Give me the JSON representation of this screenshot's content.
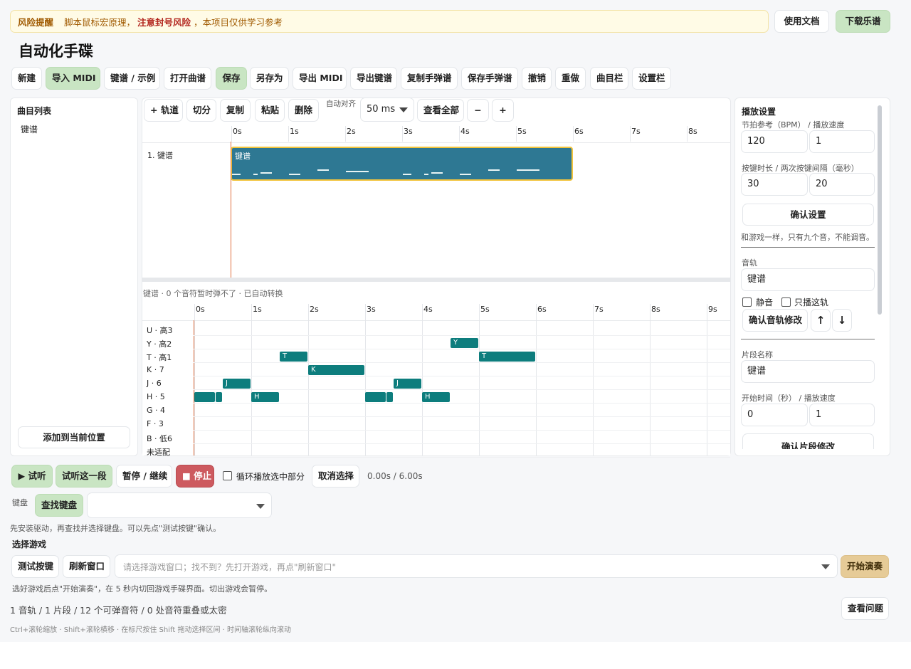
{
  "banner": {
    "title": "风险提醒",
    "text_a": "脚本鼠标宏原理，",
    "text_emph": "注意封号风险",
    "text_b": "，本项目仅供学习参考",
    "docs_button": "使用文档",
    "download_button": "下载乐谱"
  },
  "app_title": "自动化手碟",
  "toolbar": {
    "new": "新建",
    "import_midi": "导入 MIDI",
    "keyscore_example": "键谱 / 示例",
    "open_song": "打开曲谱",
    "save": "保存",
    "save_as": "另存为",
    "export_midi": "导出 MIDI",
    "export_keyscore": "导出键谱",
    "copy_handscore": "复制手弹谱",
    "save_handscore": "保存手弹谱",
    "undo": "撤销",
    "redo": "重做",
    "song_bar": "曲目栏",
    "settings_bar": "设置栏"
  },
  "song_list": {
    "title": "曲目列表",
    "items": [
      "键谱"
    ],
    "add_button": "添加到当前位置"
  },
  "editor_toolbar": {
    "add_track": "+ 轨道",
    "split": "切分",
    "copy": "复制",
    "paste": "粘贴",
    "delete": "删除",
    "snap_label": "自动对齐",
    "snap_value": "50 ms",
    "view_all": "查看全部",
    "zoom_out": "−",
    "zoom_in": "+"
  },
  "timeline": {
    "ticks": [
      "0s",
      "1s",
      "2s",
      "3s",
      "4s",
      "5s",
      "6s",
      "7s",
      "8s"
    ],
    "track_name": "1. 键谱",
    "clip_name": "键谱",
    "clip_start_s": 0,
    "clip_end_s": 6
  },
  "piano_roll": {
    "status": "键谱 · 0 个音符暂时弹不了 · 已自动转换",
    "ticks": [
      "0s",
      "1s",
      "2s",
      "3s",
      "4s",
      "5s",
      "6s",
      "7s",
      "8s",
      "9s"
    ],
    "rows": [
      "U · 高3",
      "Y · 高2",
      "T · 高1",
      "K · 7",
      "J · 6",
      "H · 5",
      "G · 4",
      "F · 3",
      "B · 低6",
      "未适配"
    ],
    "notes": [
      {
        "row": 1,
        "start": 4.5,
        "end": 5.0,
        "label": "Y"
      },
      {
        "row": 2,
        "start": 1.5,
        "end": 2.0,
        "label": "T"
      },
      {
        "row": 2,
        "start": 5.0,
        "end": 6.0,
        "label": "T"
      },
      {
        "row": 3,
        "start": 2.0,
        "end": 3.0,
        "label": "K"
      },
      {
        "row": 4,
        "start": 0.5,
        "end": 1.0,
        "label": "J"
      },
      {
        "row": 4,
        "start": 3.5,
        "end": 4.0,
        "label": "J"
      },
      {
        "row": 5,
        "start": 0.0,
        "end": 0.375,
        "label": ""
      },
      {
        "row": 5,
        "start": 0.375,
        "end": 0.5,
        "label": ""
      },
      {
        "row": 5,
        "start": 1.0,
        "end": 1.5,
        "label": "H"
      },
      {
        "row": 5,
        "start": 3.0,
        "end": 3.375,
        "label": ""
      },
      {
        "row": 5,
        "start": 3.375,
        "end": 3.5,
        "label": ""
      },
      {
        "row": 5,
        "start": 4.0,
        "end": 4.5,
        "label": "H"
      }
    ]
  },
  "playback_settings": {
    "title": "播放设置",
    "bpm_label": "节拍参考（BPM） / 播放速度",
    "bpm_value": "120",
    "speed_value": "1",
    "press_label": "按键时长 / 两次按键间隔（毫秒）",
    "press_value": "30",
    "interval_value": "20",
    "confirm_settings": "确认设置",
    "hint": "和游戏一样，只有九个音，不能调音。",
    "track_label": "音轨",
    "track_value": "键谱",
    "mute_label": "静音",
    "solo_label": "只播这轨",
    "confirm_track": "确认音轨修改",
    "up": "↑",
    "down": "↓",
    "clip_name_label": "片段名称",
    "clip_name_value": "键谱",
    "start_label": "开始时间（秒） / 播放速度",
    "start_value": "0",
    "clip_speed_value": "1",
    "confirm_clip": "确认片段修改"
  },
  "transport": {
    "preview": "▶ 试听",
    "preview_segment": "试听这一段",
    "pause_resume": "暂停 / 继续",
    "stop": "■ 停止",
    "loop_label": "循环播放选中部分",
    "cancel_selection": "取消选择",
    "time": "0.00s / 6.00s"
  },
  "keyboard": {
    "label": "键盘",
    "find_button": "查找键盘",
    "select_value": "",
    "hint": "先安装驱动，再查找并选择键盘。可以先点\"测试按键\"确认。"
  },
  "game": {
    "title": "选择游戏",
    "test_keys": "测试按键",
    "refresh_window": "刷新窗口",
    "window_placeholder": "请选择游戏窗口；找不到？先打开游戏，再点\"刷新窗口\"",
    "start_button": "开始演奏",
    "hint": "选好游戏后点\"开始演奏\"，在 5 秒内切回游戏手碟界面。切出游戏会暂停。"
  },
  "summary": {
    "text": "1 音轨 / 1 片段 / 12 个可弹音符 / 0 处音符重叠或太密",
    "issues_button": "查看问题"
  },
  "footer_hint": "Ctrl+滚轮缩放 · Shift+滚轮横移 · 在标尺按住 Shift 拖动选择区间 · 时间轴滚轮纵向滚动",
  "colors": {
    "accent_green": "#c9e5c3",
    "note_teal": "#0d7d7d",
    "clip_teal": "#2e7893",
    "clip_border": "#f2c43c",
    "playhead": "#e07040",
    "warning_bg": "#fffbe6",
    "stop_red": "#cd5a5f",
    "start_gold": "#e6cb97"
  }
}
